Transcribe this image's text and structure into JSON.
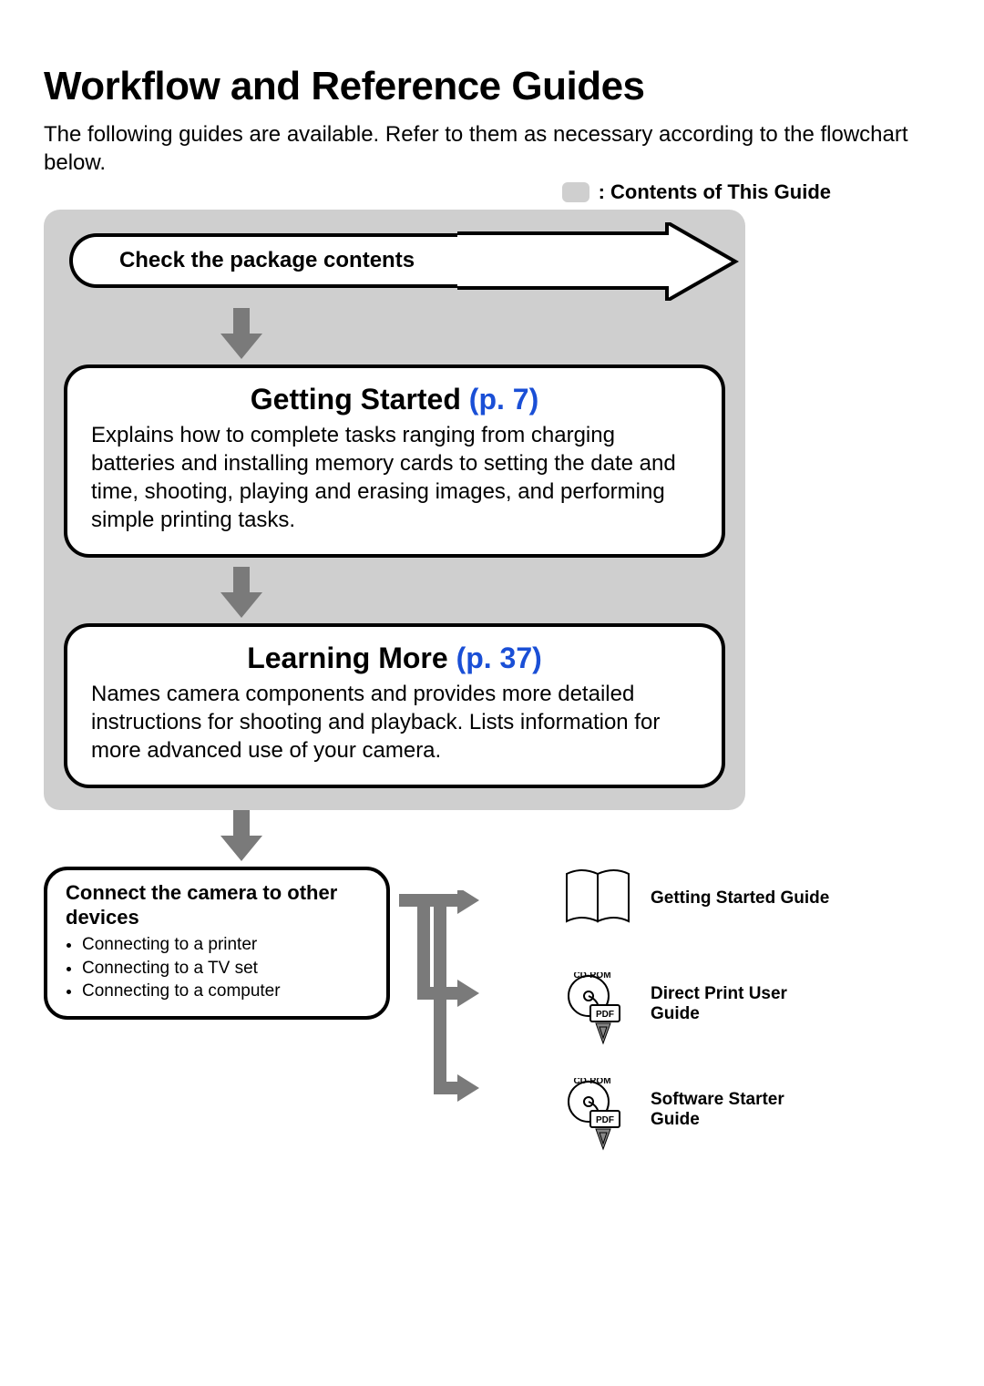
{
  "title": "Workflow and Reference Guides",
  "intro": "The following guides are available. Refer to them as necessary according to the flowchart below.",
  "legend": ": Contents of This Guide",
  "flow": {
    "check_package": "Check the package contents",
    "getting_started": {
      "heading": "Getting Started",
      "page_ref": "(p. 7)",
      "body": "Explains how to complete tasks ranging from charging batteries and installing memory cards to setting the date and time, shooting, playing and erasing images, and performing simple printing tasks."
    },
    "learning_more": {
      "heading": "Learning More",
      "page_ref": "(p. 37)",
      "body": "Names camera components and provides more detailed instructions for shooting and playback. Lists information for more advanced use of your camera."
    },
    "connect": {
      "title": "Connect the camera to other devices",
      "items": [
        "Connecting to a printer",
        "Connecting to a TV set",
        "Connecting to a computer"
      ]
    }
  },
  "guides": [
    {
      "label": "Getting Started Guide",
      "type": "book"
    },
    {
      "label": "Direct Print User Guide",
      "type": "cdrom"
    },
    {
      "label": "Software Starter Guide",
      "type": "cdrom"
    }
  ],
  "cdrom_label": "CD-ROM",
  "pdf_label": "PDF"
}
